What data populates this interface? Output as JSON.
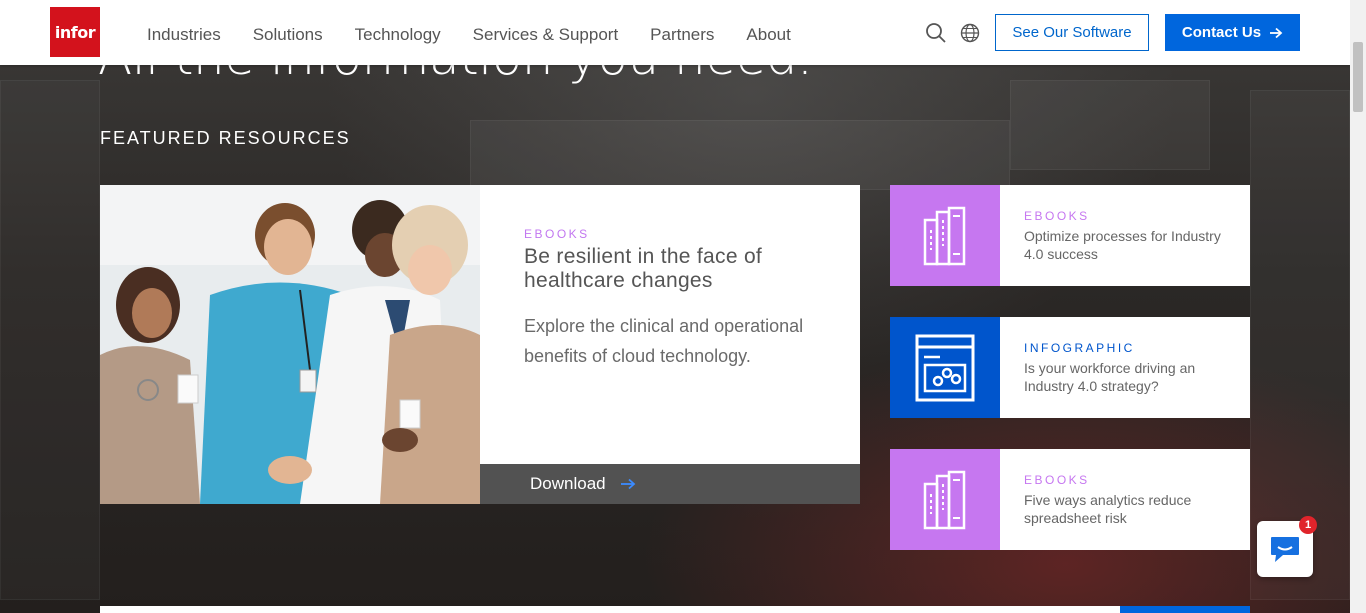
{
  "header": {
    "logo_text": "infor",
    "nav": [
      "Industries",
      "Solutions",
      "Technology",
      "Services & Support",
      "Partners",
      "About"
    ],
    "see_software_label": "See Our Software",
    "contact_label": "Contact Us"
  },
  "hero": {
    "heading": "All the information you need."
  },
  "featured": {
    "section_title": "FEATURED RESOURCES",
    "main": {
      "tag": "EBOOKS",
      "title": "Be resilient in the face of healthcare changes",
      "description": "Explore the clinical and operational benefits of cloud technology.",
      "download_label": "Download"
    },
    "cards": [
      {
        "tag": "EBOOKS",
        "title": "Optimize processes for Industry 4.0 success",
        "color": "#c677f0",
        "icon": "books-icon"
      },
      {
        "tag": "INFOGRAPHIC",
        "title": "Is your workforce driving an Industry 4.0 strategy?",
        "color": "#0055cc",
        "icon": "infographic-icon"
      },
      {
        "tag": "EBOOKS",
        "title": "Five ways analytics reduce spreadsheet risk",
        "color": "#c677f0",
        "icon": "books-icon"
      }
    ]
  },
  "chat": {
    "badge_count": "1"
  },
  "colors": {
    "brand_red": "#d3121c",
    "primary_blue": "#0066dd",
    "ebook_purple": "#c677f0",
    "infographic_blue": "#0055cc"
  }
}
